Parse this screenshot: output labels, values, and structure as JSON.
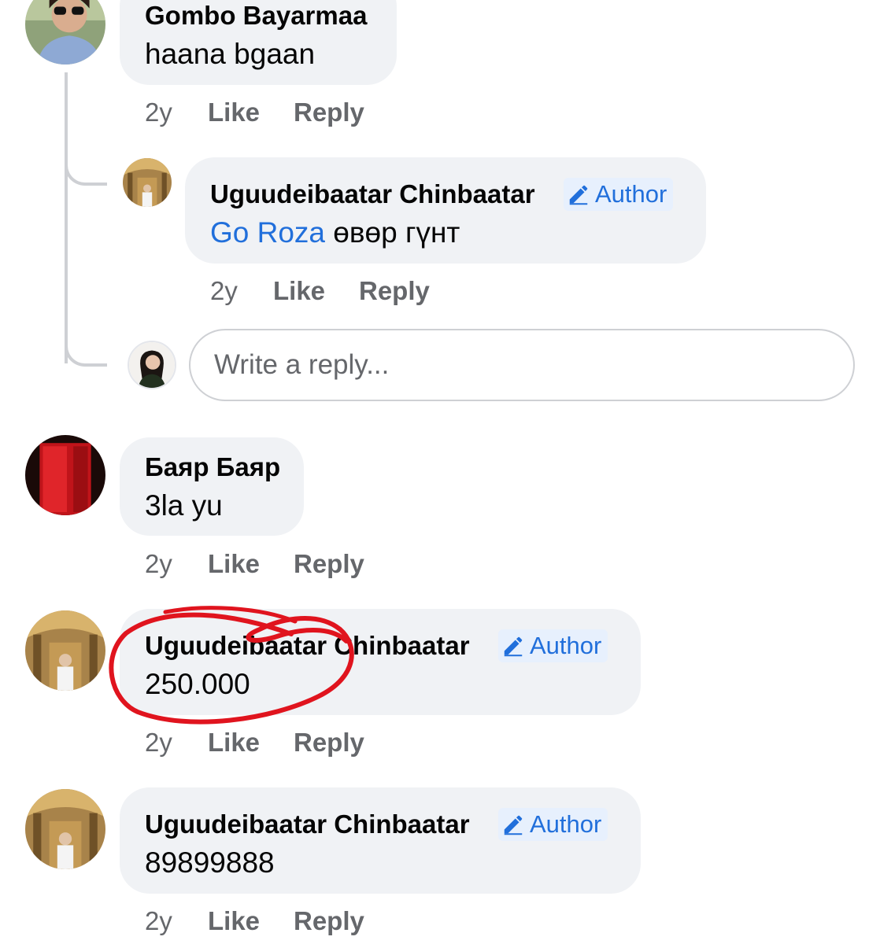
{
  "author_badge_label": "Author",
  "comments": [
    {
      "name": "Gombo Bayarmaa",
      "text": "haana bgaan",
      "age": "2y",
      "like": "Like",
      "reply": "Reply"
    },
    {
      "name": "Uguudeibaatar Chinbaatar",
      "mention": "Go Roza",
      "text": " өвөр гүнт",
      "age": "2y",
      "like": "Like",
      "reply": "Reply"
    },
    {
      "name": "Баяр Баяр",
      "text": "3la yu",
      "age": "2y",
      "like": "Like",
      "reply": "Reply"
    },
    {
      "name": "Uguudeibaatar Chinbaatar",
      "text": "250.000",
      "age": "2y",
      "like": "Like",
      "reply": "Reply"
    },
    {
      "name": "Uguudeibaatar Chinbaatar",
      "text": "89899888",
      "age": "2y",
      "like": "Like",
      "reply": "Reply"
    }
  ],
  "reply_box": {
    "placeholder": "Write a reply..."
  },
  "colors": {
    "link": "#216fdb",
    "bubble": "#f0f2f5",
    "meta": "#65676b",
    "annotation": "#e0141e"
  }
}
